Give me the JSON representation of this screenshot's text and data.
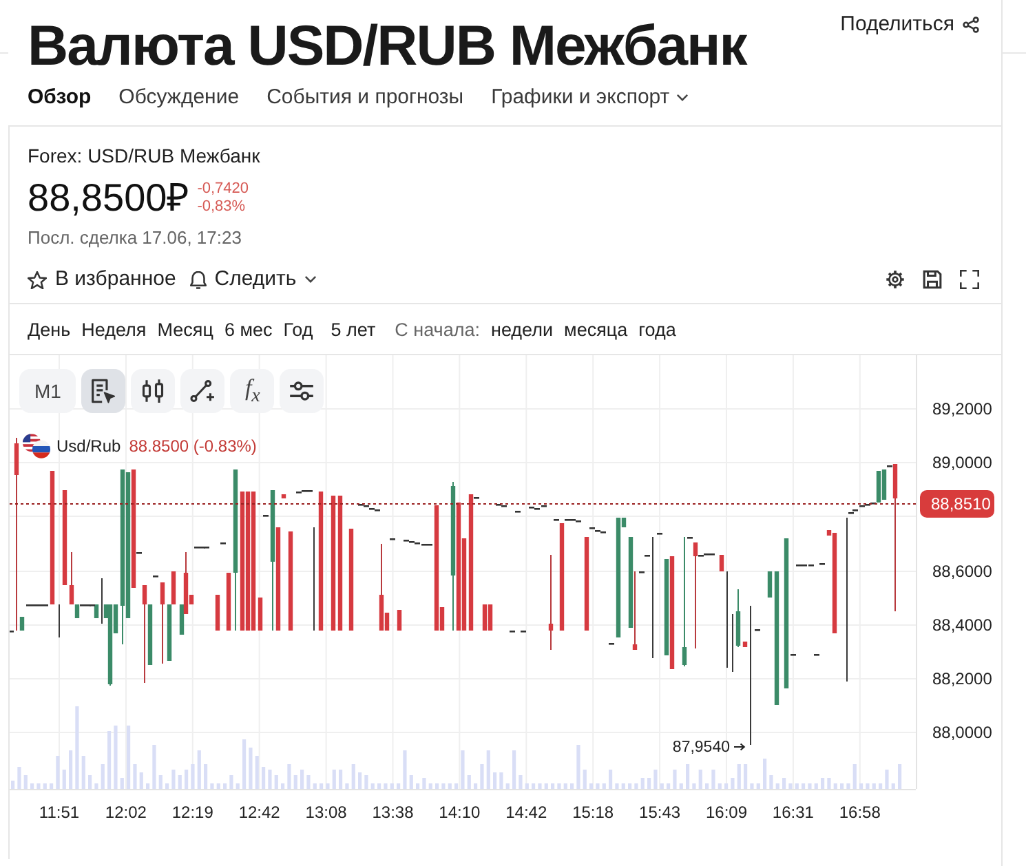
{
  "header": {
    "title": "Валюта USD/RUB Межбанк",
    "share": "Поделиться"
  },
  "tabs": [
    {
      "label": "Обзор",
      "selected": true,
      "dropdown": false
    },
    {
      "label": "Обсуждение",
      "selected": false,
      "dropdown": false
    },
    {
      "label": "События и прогнозы",
      "selected": false,
      "dropdown": false
    },
    {
      "label": "Графики и экспорт",
      "selected": false,
      "dropdown": true
    }
  ],
  "quote": {
    "name": "Forex: USD/RUB Межбанк",
    "price": "88,8500₽",
    "change": "-0,7420",
    "change_percent": "-0,83%",
    "last_trade": "Посл. сделка 17.06, 17:23"
  },
  "actions": [
    {
      "kind": "favorite",
      "label": "В избранное",
      "dropdown": false
    },
    {
      "kind": "follow",
      "label": "Следить",
      "dropdown": true
    }
  ],
  "chart_controls": [
    {
      "kind": "settings"
    },
    {
      "kind": "save"
    },
    {
      "kind": "fullscreen"
    }
  ],
  "periods": {
    "ranges": [
      "День",
      "Неделя",
      "Месяц",
      "6 мес",
      "Год",
      "5 лет"
    ],
    "since_label": "С начала:",
    "since": [
      "недели",
      "месяца",
      "года"
    ]
  },
  "chart": {
    "toolbar": [
      {
        "kind": "interval",
        "label": "M1",
        "selected": false
      },
      {
        "kind": "notes",
        "selected": true
      },
      {
        "kind": "candles",
        "selected": false
      },
      {
        "kind": "drawing",
        "selected": false
      },
      {
        "kind": "formula",
        "label": "f$_{x}$",
        "selected": false
      },
      {
        "kind": "settings",
        "selected": false
      }
    ],
    "legend": {
      "symbol": "Usd/Rub",
      "value": "88.8500 (-0.83%)"
    },
    "price_ticks": [
      "89,2000",
      "89,0000",
      "88,6000",
      "88,4000",
      "88,2000",
      "88,0000"
    ],
    "current_price": "88,8510",
    "low_marker": "87,9540",
    "time_ticks": [
      "11:51",
      "12:02",
      "12:19",
      "12:42",
      "13:08",
      "13:38",
      "14:10",
      "14:42",
      "15:18",
      "15:43",
      "16:09",
      "16:31",
      "16:58"
    ]
  }
}
